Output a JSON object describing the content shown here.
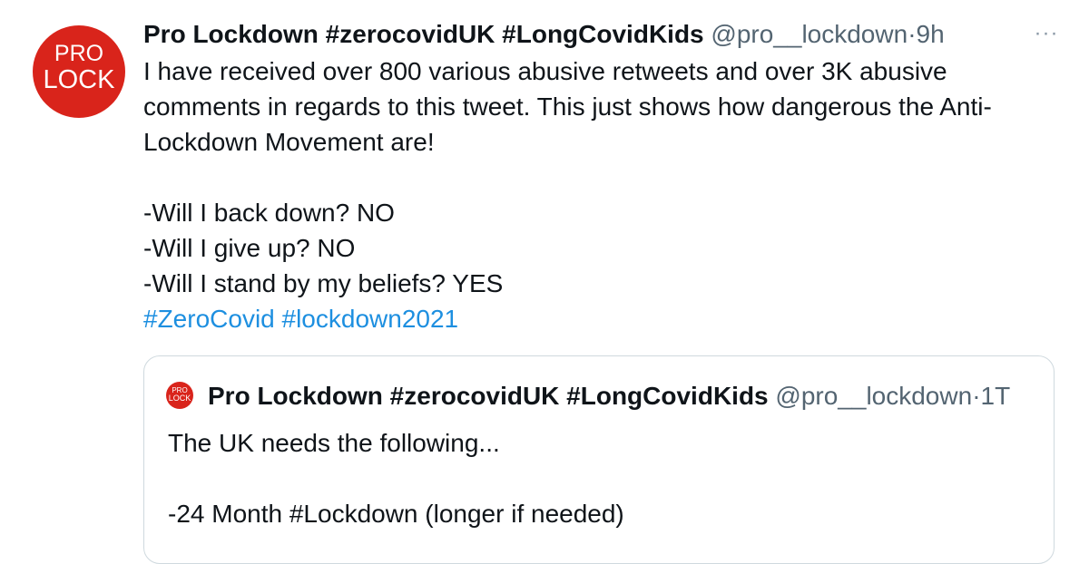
{
  "tweet": {
    "avatar": {
      "line1": "PRO",
      "line2": "LOCK",
      "color": "#d9241b",
      "icon": "pro-lock-avatar"
    },
    "display_name": "Pro Lockdown #zerocovidUK #LongCovidKids",
    "handle": "@pro__lockdown",
    "separator": "·",
    "time": "9h",
    "more_icon": "···",
    "body_lines": [
      "I have received over 800 various abusive retweets and over 3K abusive",
      "comments in regards to this tweet. This just shows how dangerous the Anti-",
      "Lockdown Movement are!",
      "",
      "-Will I back down? NO",
      "-Will I give up? NO",
      "-Will I stand by my beliefs? YES"
    ],
    "hashtags": [
      "#ZeroCovid",
      "#lockdown2021"
    ],
    "hashtag_color": "#1d8fe0"
  },
  "quoted_tweet": {
    "avatar": {
      "line1": "PRO",
      "line2": "LOCK"
    },
    "display_name": "Pro Lockdown #zerocovidUK #LongCovidKids",
    "handle": "@pro__lockdown",
    "separator": "·",
    "time": "1T",
    "body_lines": [
      "The UK needs the following...",
      "",
      "-24 Month #Lockdown (longer if needed)"
    ]
  }
}
